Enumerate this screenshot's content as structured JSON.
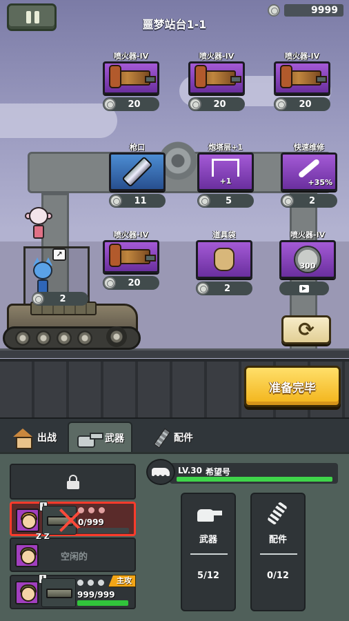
{
  "currency": {
    "icon": "gear-coin-icon",
    "amount": "9999"
  },
  "stage": {
    "title": "噩梦站台1-1"
  },
  "shop": {
    "items": [
      {
        "name": "喷火器-IV",
        "icon": "flamethrower-icon",
        "rarity": "purple",
        "price": "20"
      },
      {
        "name": "喷火器-IV",
        "icon": "flamethrower-icon",
        "rarity": "purple",
        "price": "20"
      },
      {
        "name": "喷火器-IV",
        "icon": "flamethrower-icon",
        "rarity": "purple",
        "price": "20"
      },
      {
        "name": "枪口",
        "icon": "muzzle-icon",
        "rarity": "blue",
        "price": "11"
      },
      {
        "name": "炮塔层+1",
        "icon": "turret-layer-icon",
        "rarity": "purple",
        "price": "5",
        "tag": "+1"
      },
      {
        "name": "快速维修",
        "icon": "wrench-icon",
        "rarity": "purple",
        "price": "2",
        "tag": "+35%"
      },
      {
        "name": "喷火器-IV",
        "icon": "flamethrower-icon",
        "rarity": "purple",
        "price": "20"
      },
      {
        "name": "道具袋",
        "icon": "item-bag-icon",
        "rarity": "purple",
        "price": "2"
      },
      {
        "name": "喷火器-IV",
        "icon": "coin-pile-icon",
        "rarity": "purple",
        "tag": "300",
        "price_icon": "video-ad-icon"
      }
    ]
  },
  "tank": {
    "slot_price": "2",
    "slot_sign": "↗"
  },
  "buttons": {
    "refresh_icon": "refresh-icon",
    "ready": "准备完毕"
  },
  "tabs": [
    {
      "label": "出战",
      "icon": "house-icon"
    },
    {
      "label": "武器",
      "icon": "turret-icon",
      "active": true
    },
    {
      "label": "配件",
      "icon": "parts-icon"
    }
  ],
  "crew": [
    {
      "state": "locked"
    },
    {
      "state": "selected",
      "tier": "I",
      "hp": "0/999",
      "hp_fraction": 0
    },
    {
      "state": "idle",
      "label": "空闲的",
      "zzz": "Z Z"
    },
    {
      "state": "main",
      "tier": "I",
      "hp": "999/999",
      "hp_fraction": 1,
      "badge": "主攻"
    }
  ],
  "vehicle": {
    "level": "LV.30",
    "name": "希望号",
    "progress": 1
  },
  "stats": [
    {
      "label": "武器",
      "count": "5/12",
      "icon": "turret-icon"
    },
    {
      "label": "配件",
      "count": "0/12",
      "icon": "parts-icon"
    }
  ]
}
